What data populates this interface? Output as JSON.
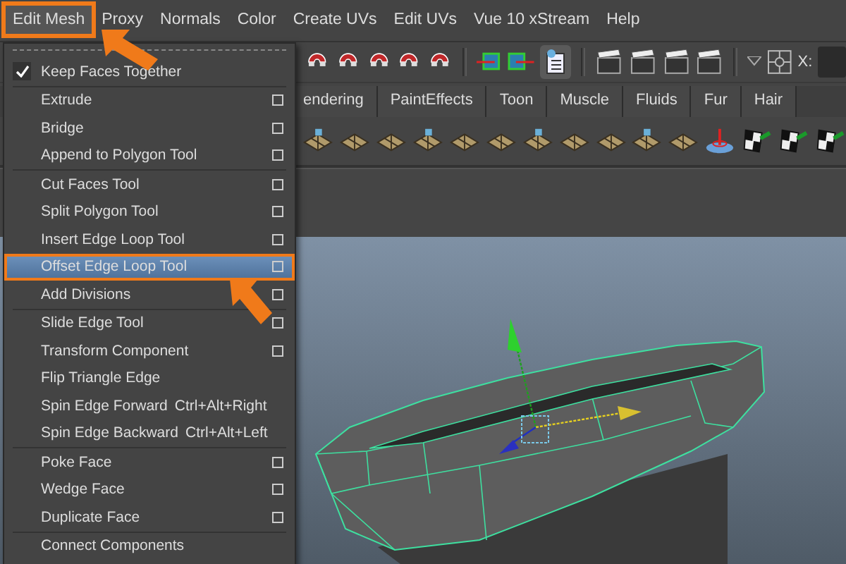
{
  "menu_bar": [
    {
      "label": "Edit Mesh",
      "selected": true
    },
    {
      "label": "Proxy",
      "selected": false
    },
    {
      "label": "Normals",
      "selected": false
    },
    {
      "label": "Color",
      "selected": false
    },
    {
      "label": "Create UVs",
      "selected": false
    },
    {
      "label": "Edit UVs",
      "selected": false
    },
    {
      "label": "Vue 10 xStream",
      "selected": false
    },
    {
      "label": "Help",
      "selected": false
    }
  ],
  "menu": {
    "items": [
      {
        "kind": "check",
        "label": "Keep Faces Together",
        "checked": true
      },
      {
        "kind": "separator"
      },
      {
        "kind": "item",
        "label": "Extrude",
        "option_box": true,
        "selected": false
      },
      {
        "kind": "item",
        "label": "Bridge",
        "option_box": true,
        "selected": false
      },
      {
        "kind": "item",
        "label": "Append to Polygon Tool",
        "option_box": true,
        "selected": false
      },
      {
        "kind": "separator"
      },
      {
        "kind": "item",
        "label": "Cut Faces Tool",
        "option_box": true,
        "selected": false
      },
      {
        "kind": "item",
        "label": "Split Polygon Tool",
        "option_box": true,
        "selected": false
      },
      {
        "kind": "item",
        "label": "Insert Edge Loop Tool",
        "option_box": true,
        "selected": false
      },
      {
        "kind": "item",
        "label": "Offset Edge Loop Tool",
        "option_box": true,
        "selected": true
      },
      {
        "kind": "item",
        "label": "Add Divisions",
        "option_box": true,
        "selected": false
      },
      {
        "kind": "separator"
      },
      {
        "kind": "item",
        "label": "Slide Edge Tool",
        "option_box": true,
        "selected": false
      },
      {
        "kind": "item",
        "label": "Transform Component",
        "option_box": true,
        "selected": false
      },
      {
        "kind": "item",
        "label": "Flip Triangle Edge",
        "option_box": false,
        "selected": false
      },
      {
        "kind": "item",
        "label": "Spin Edge Forward",
        "shortcut": "Ctrl+Alt+Right",
        "option_box": false,
        "selected": false
      },
      {
        "kind": "item",
        "label": "Spin Edge Backward",
        "shortcut": "Ctrl+Alt+Left",
        "option_box": false,
        "selected": false
      },
      {
        "kind": "separator"
      },
      {
        "kind": "item",
        "label": "Poke Face",
        "option_box": true,
        "selected": false
      },
      {
        "kind": "item",
        "label": "Wedge Face",
        "option_box": true,
        "selected": false
      },
      {
        "kind": "item",
        "label": "Duplicate Face",
        "option_box": true,
        "selected": false
      },
      {
        "kind": "separator"
      },
      {
        "kind": "item",
        "label": "Connect Components",
        "option_box": false,
        "selected": false
      }
    ]
  },
  "toolbar": {
    "x_label": "X:"
  },
  "shelf_tabs": [
    {
      "label": "endering",
      "selected": false
    },
    {
      "label": "PaintEffects",
      "selected": false
    },
    {
      "label": "Toon",
      "selected": false
    },
    {
      "label": "Muscle",
      "selected": false
    },
    {
      "label": "Fluids",
      "selected": false
    },
    {
      "label": "Fur",
      "selected": false
    },
    {
      "label": "Hair",
      "selected": false
    }
  ]
}
